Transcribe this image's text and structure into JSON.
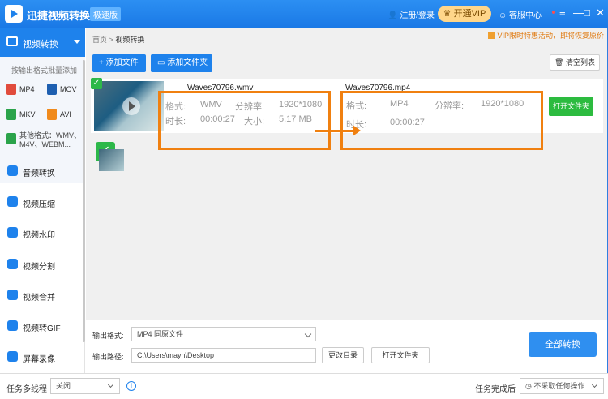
{
  "titlebar": {
    "app_name": "迅捷视频转换器",
    "edition_badge": "极速版",
    "login": "注册/登录",
    "vip_button": "开通VIP",
    "service": "客服中心",
    "controls": [
      "≡",
      "—",
      "□",
      "✕"
    ]
  },
  "sidebar": {
    "active_item": "视频转换",
    "hint": "按输出格式批量添加",
    "formats": [
      {
        "label": "MP4",
        "color": "#e14b3c"
      },
      {
        "label": "MOV",
        "color": "#1e5fb0"
      },
      {
        "label": "MKV",
        "color": "#2aa34a"
      },
      {
        "label": "AVI",
        "color": "#f08a1c"
      }
    ],
    "other_formats": "其他格式：WMV、M4V、WEBM...",
    "items": [
      {
        "label": "音频转换",
        "icon": "audio-icon"
      },
      {
        "label": "视频压缩",
        "icon": "compress-icon"
      },
      {
        "label": "视频水印",
        "icon": "watermark-icon"
      },
      {
        "label": "视频分割",
        "icon": "split-icon"
      },
      {
        "label": "视频合并",
        "icon": "merge-icon"
      },
      {
        "label": "视频转GIF",
        "icon": "gif-icon"
      },
      {
        "label": "屏幕录像",
        "icon": "record-icon"
      }
    ]
  },
  "main": {
    "breadcrumb_home": "首页",
    "breadcrumb_sep": ">",
    "breadcrumb_current": "视频转换",
    "promo": "VIP限时特惠活动，即将恢复原价",
    "add_file": "添加文件",
    "add_folder": "添加文件夹",
    "clear_list": "清空列表",
    "file": {
      "source_name": "Waves70796.wmv",
      "source_format_label": "格式:",
      "source_format": "WMV",
      "source_res_label": "分辨率:",
      "source_res": "1920*1080",
      "source_duration_label": "时长:",
      "source_duration": "00:00:27",
      "source_size_label": "大小:",
      "source_size": "5.17 MB",
      "target_name": "Waves70796.mp4",
      "target_format_label": "格式:",
      "target_format": "MP4",
      "target_res_label": "分辨率:",
      "target_res": "1920*1080",
      "target_duration_label": "时长:",
      "target_duration": "00:00:27",
      "open_folder": "打开文件夹"
    },
    "output_format_label": "输出格式:",
    "output_format_value": "MP4  同原文件",
    "output_path_label": "输出路径:",
    "output_path_value": "C:\\Users\\mayn\\Desktop",
    "change_dir": "更改目录",
    "open_folder": "打开文件夹",
    "convert_all": "全部转换"
  },
  "statusbar": {
    "multithread_label": "任务多线程",
    "multithread_value": "关闭",
    "after_done_label": "任务完成后",
    "after_done_value": "不采取任何操作"
  },
  "colors": {
    "accent": "#1e82ec",
    "highlight": "#f08010",
    "success": "#2cbb3f"
  }
}
